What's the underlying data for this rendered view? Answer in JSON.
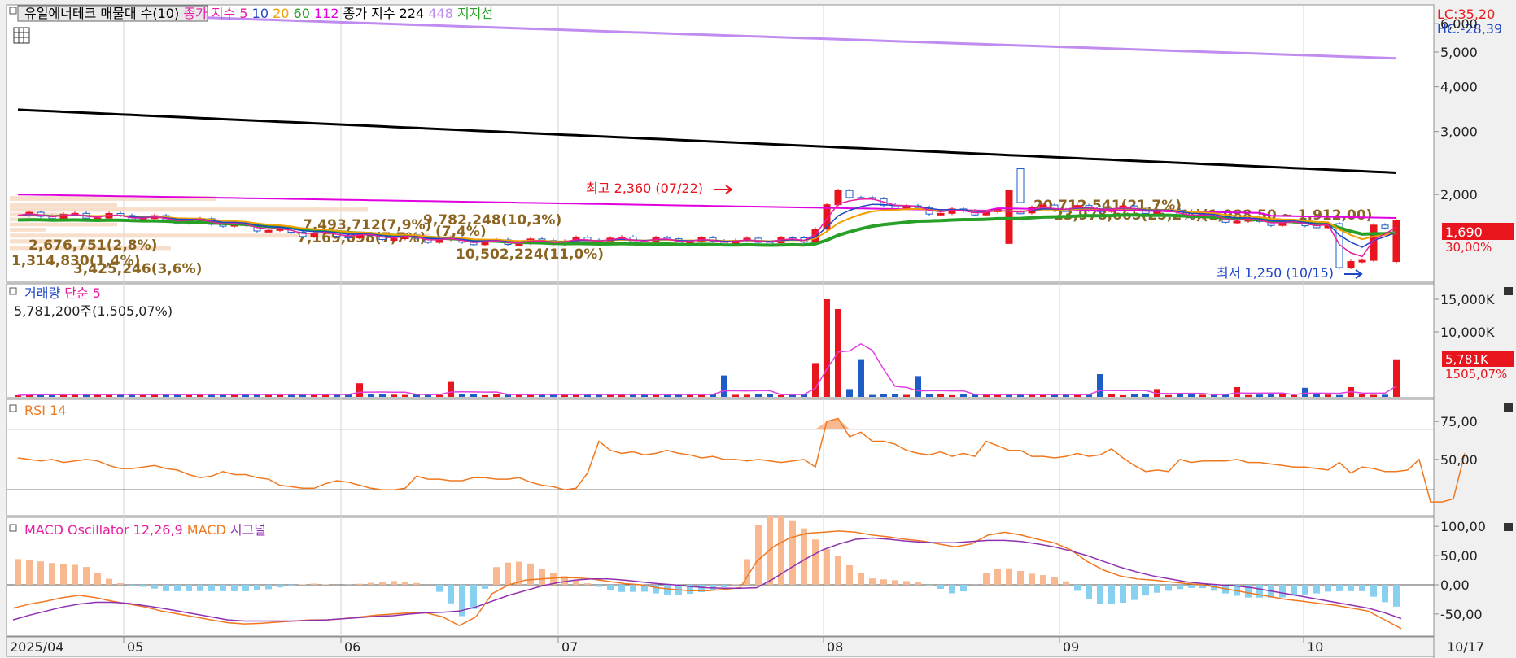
{
  "colors": {
    "up": "#e8141e",
    "down": "#1e5cc8",
    "ma5": "#e81ea0",
    "ma10": "#1e46c8",
    "ma20": "#f0a000",
    "ma60": "#28a028",
    "ma112": "#e000e0",
    "ma224": "#000000",
    "ma448": "#c08cf0",
    "rsi": "#f07820",
    "macd": "#f07820",
    "signal": "#9030b0",
    "osc_pos": "#f8b890",
    "osc_neg": "#88d0f0",
    "vol_ma": "#e040e0",
    "profile": "#f5d7bf",
    "profile_text": "#8a6420"
  },
  "price_panel": {
    "legend": [
      {
        "text": "유일에너테크 매물대 수(10)",
        "color": "#000000",
        "boxed": true
      },
      {
        "text": "종가 지수 5",
        "color": "#e81ea0"
      },
      {
        "text": "10",
        "color": "#1e46c8"
      },
      {
        "text": "20",
        "color": "#f0a000"
      },
      {
        "text": "60",
        "color": "#28a028"
      },
      {
        "text": "112",
        "color": "#e000e0"
      },
      {
        "text": "종가 지수 224",
        "color": "#000000"
      },
      {
        "text": "448",
        "color": "#c08cf0"
      },
      {
        "text": "지지선",
        "color": "#28a028"
      }
    ],
    "lc_label": "LC:35,20",
    "hc_label": "HC:-28,39",
    "y_ticks": [
      "6,000",
      "5,000",
      "4,000",
      "3,000",
      "2,000"
    ],
    "current_price": "1,690",
    "current_pct": "30,00%",
    "high_label": "최고 2,360 (07/22)",
    "low_label": "최저 1,250 (10/15)",
    "volume_profile": [
      "20,712,541(21,7%)",
      "23,978,665(25,2%)(1,988,50 ~ 1,912,00)",
      "9,782,248(10,3%)",
      "7,493,712(7,9%)",
      "7,169,098(7,7%)",
      "(7,4%)",
      "10,502,224(11,0%)",
      "2,676,751(2,8%)",
      "1,314,830(1,4%)",
      "3,425,246(3,6%)"
    ]
  },
  "volume_panel": {
    "legend": [
      {
        "text": "거래량",
        "color": "#1e46c8"
      },
      {
        "text": "단순 5",
        "color": "#e81ea0"
      }
    ],
    "sub_label": "5,781,200주(1,505,07%)",
    "y_ticks": [
      "15,000K",
      "10,000K"
    ],
    "current_vol": "5,781K",
    "current_pct": "1505,07%"
  },
  "rsi_panel": {
    "legend": [
      {
        "text": "RSI 14",
        "color": "#f07820"
      }
    ],
    "y_ticks": [
      "75,00",
      "50,00"
    ]
  },
  "macd_panel": {
    "legend": [
      {
        "text": "MACD Oscillator 12,26,9",
        "color": "#e81ea0"
      },
      {
        "text": "MACD",
        "color": "#f07820"
      },
      {
        "text": "시그널",
        "color": "#9030b0"
      }
    ],
    "y_ticks": [
      "100,00",
      "50,00",
      "0,00",
      "-50,00"
    ]
  },
  "x_axis": {
    "labels": [
      "2025/04",
      "05",
      "06",
      "07",
      "08",
      "09",
      "10"
    ],
    "right_label": "10/17"
  },
  "chart_data": {
    "type": "candlestick",
    "title": "유일에너테크",
    "scale": "log",
    "ylim": [
      1150,
      6700
    ],
    "high": {
      "value": 2360,
      "date": "07/22"
    },
    "low": {
      "value": 1250,
      "date": "10/15"
    },
    "last_close": 1690,
    "ma224": {
      "start": 3450,
      "end": 2300
    },
    "ma448": {
      "start": 6500,
      "end": 4800
    },
    "volume_peaks_k": [
      {
        "date": "07/22",
        "value": 15000
      },
      {
        "date": "07/23",
        "value": 13500
      },
      {
        "date": "10/17",
        "value": 5781
      }
    ],
    "rsi": [
      51,
      50,
      49,
      50,
      48,
      49,
      50,
      49,
      46,
      44,
      44,
      45,
      46,
      44,
      43,
      40,
      38,
      39,
      42,
      40,
      40,
      38,
      37,
      33,
      32,
      31,
      31,
      34,
      36,
      35,
      33,
      31,
      30,
      30,
      31,
      39,
      37,
      37,
      36,
      36,
      38,
      38,
      37,
      37,
      38,
      35,
      33,
      32,
      30,
      31,
      41,
      62,
      56,
      54,
      55,
      53,
      54,
      56,
      54,
      53,
      51,
      52,
      50,
      50,
      49,
      50,
      49,
      48,
      49,
      50,
      45,
      75,
      77,
      65,
      68,
      62,
      62,
      60,
      56,
      54,
      53,
      55,
      52,
      54,
      52,
      62,
      59,
      56,
      56,
      52,
      52,
      51,
      52,
      54,
      52,
      53,
      57,
      51,
      46,
      42,
      43,
      42,
      50,
      48,
      49,
      49,
      49,
      50,
      48,
      48,
      47,
      46,
      45,
      45,
      44,
      43,
      48,
      41,
      45,
      44,
      42,
      42,
      43,
      50,
      22,
      22,
      24,
      54
    ],
    "macd": [
      -40,
      -33,
      -28,
      -22,
      -18,
      -22,
      -28,
      -33,
      -38,
      -45,
      -50,
      -55,
      -60,
      -65,
      -67,
      -66,
      -64,
      -62,
      -60,
      -60,
      -58,
      -55,
      -52,
      -50,
      -48,
      -48,
      -55,
      -70,
      -55,
      -15,
      0,
      8,
      10,
      12,
      12,
      10,
      6,
      2,
      0,
      -5,
      -8,
      -10,
      -10,
      -8,
      -5,
      40,
      65,
      80,
      88,
      90,
      92,
      90,
      85,
      82,
      78,
      75,
      70,
      65,
      70,
      85,
      90,
      85,
      78,
      72,
      60,
      40,
      25,
      15,
      10,
      8,
      5,
      2,
      0,
      -5,
      -10,
      -15,
      -20,
      -25,
      -28,
      -32,
      -35,
      -40,
      -45,
      -60,
      -75
    ],
    "signal": [
      -60,
      -52,
      -45,
      -38,
      -33,
      -30,
      -30,
      -32,
      -36,
      -40,
      -45,
      -50,
      -55,
      -60,
      -62,
      -62,
      -62,
      -62,
      -61,
      -60,
      -58,
      -56,
      -54,
      -53,
      -50,
      -48,
      -47,
      -45,
      -38,
      -28,
      -18,
      -10,
      -2,
      4,
      8,
      10,
      10,
      8,
      5,
      2,
      0,
      -3,
      -5,
      -6,
      -6,
      -5,
      10,
      28,
      45,
      60,
      70,
      78,
      80,
      78,
      75,
      73,
      72,
      72,
      74,
      76,
      76,
      74,
      70,
      65,
      58,
      50,
      40,
      30,
      22,
      15,
      10,
      5,
      2,
      0,
      -2,
      -5,
      -10,
      -15,
      -20,
      -25,
      -30,
      -35,
      -40,
      -48,
      -58
    ]
  }
}
